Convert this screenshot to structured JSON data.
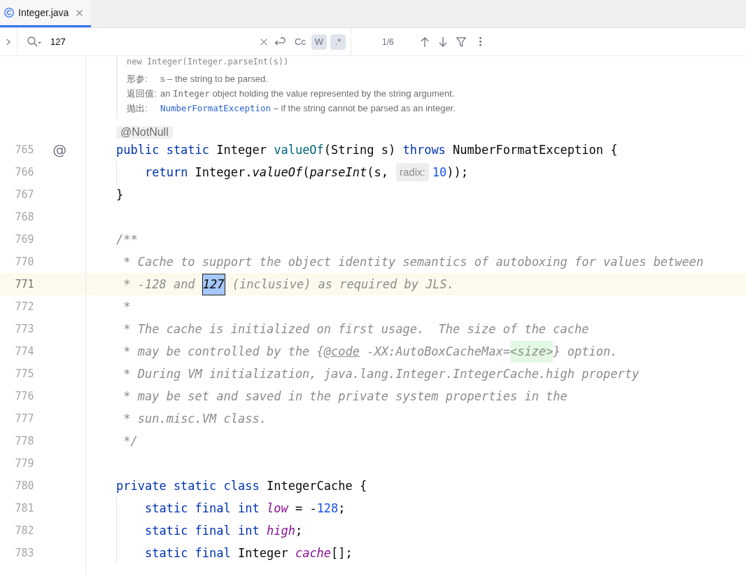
{
  "tabs": [
    {
      "label": "Integer.java",
      "selected": true
    }
  ],
  "search": {
    "value": "127",
    "options": [
      {
        "label": "Cc",
        "selected": false
      },
      {
        "label": "W",
        "selected": true
      },
      {
        "label": ".*",
        "selected": true
      }
    ],
    "match_count": "1/6"
  },
  "editor": {
    "doc": {
      "signature": "new Integer(Integer.parseInt(s))",
      "rows": [
        {
          "label": "形参:",
          "parts": [
            {
              "kind": "text",
              "text": "s – the string to be parsed."
            }
          ]
        },
        {
          "label": "返回值:",
          "parts": [
            {
              "kind": "text",
              "text": "an "
            },
            {
              "kind": "code",
              "text": "Integer"
            },
            {
              "kind": "text",
              "text": " object holding the value represented by the string argument."
            }
          ]
        },
        {
          "label": "抛出:",
          "parts": [
            {
              "kind": "link",
              "text": "NumberFormatException"
            },
            {
              "kind": "text",
              "text": " – if the string cannot be parsed as an integer."
            }
          ]
        }
      ]
    },
    "annotation": "@NotNull",
    "lines": [
      {
        "number": "765",
        "gutter_mark": "@",
        "current": false,
        "tokens": [
          {
            "kind": "keyword",
            "text": "public static"
          },
          {
            "kind": "plain",
            "text": " Integer "
          },
          {
            "kind": "method",
            "text": "valueOf"
          },
          {
            "kind": "plain",
            "text": "(String s) "
          },
          {
            "kind": "keyword",
            "text": "throws"
          },
          {
            "kind": "plain",
            "text": " NumberFormatException {"
          }
        ]
      },
      {
        "number": "766",
        "current": false,
        "tokens": [
          {
            "kind": "keyword",
            "text": "    return"
          },
          {
            "kind": "plain",
            "text": " Integer."
          },
          {
            "kind": "call",
            "text": "valueOf"
          },
          {
            "kind": "plain",
            "text": "("
          },
          {
            "kind": "call",
            "text": "parseInt"
          },
          {
            "kind": "plain",
            "text": "(s,"
          },
          {
            "kind": "hint",
            "text": "radix:"
          },
          {
            "kind": "number",
            "text": "10"
          },
          {
            "kind": "plain",
            "text": "));"
          }
        ]
      },
      {
        "number": "767",
        "current": false,
        "tokens": [
          {
            "kind": "plain",
            "text": "}"
          }
        ]
      },
      {
        "number": "768",
        "current": false
      },
      {
        "number": "769",
        "current": false,
        "tokens": [
          {
            "kind": "comment",
            "text": "/**"
          }
        ]
      },
      {
        "number": "770",
        "current": false,
        "tokens": [
          {
            "kind": "comment",
            "text": " * Cache to support the object identity semantics of autoboxing for values between"
          }
        ]
      },
      {
        "number": "771",
        "current": true,
        "tokens": [
          {
            "kind": "comment",
            "text": " * -128 and "
          },
          {
            "kind": "match",
            "text": "127"
          },
          {
            "kind": "comment",
            "text": " (inclusive) as required by JLS."
          }
        ]
      },
      {
        "number": "772",
        "current": false,
        "tokens": [
          {
            "kind": "comment",
            "text": " *"
          }
        ]
      },
      {
        "number": "773",
        "current": false,
        "tokens": [
          {
            "kind": "comment",
            "text": " * The cache is initialized on first usage.  The size of the cache"
          }
        ]
      },
      {
        "number": "774",
        "current": false,
        "tokens": [
          {
            "kind": "comment",
            "text": " * may be controlled by the {"
          },
          {
            "kind": "doc_tag",
            "text": "@code"
          },
          {
            "kind": "comment",
            "text": " -XX:AutoBoxCacheMax="
          },
          {
            "kind": "markup",
            "text": "<size>"
          },
          {
            "kind": "comment",
            "text": "} option."
          }
        ]
      },
      {
        "number": "775",
        "current": false,
        "tokens": [
          {
            "kind": "comment",
            "text": " * During VM initialization, java.lang.Integer.IntegerCache.high property"
          }
        ]
      },
      {
        "number": "776",
        "current": false,
        "tokens": [
          {
            "kind": "comment",
            "text": " * may be set and saved in the private system properties in the"
          }
        ]
      },
      {
        "number": "777",
        "current": false,
        "tokens": [
          {
            "kind": "comment",
            "text": " * sun.misc.VM class."
          }
        ]
      },
      {
        "number": "778",
        "current": false,
        "tokens": [
          {
            "kind": "comment",
            "text": " */"
          }
        ]
      },
      {
        "number": "779",
        "current": false
      },
      {
        "number": "780",
        "current": false,
        "tokens": [
          {
            "kind": "keyword",
            "text": "private static class"
          },
          {
            "kind": "plain",
            "text": " IntegerCache {"
          }
        ]
      },
      {
        "number": "781",
        "current": false,
        "tokens": [
          {
            "kind": "keyword",
            "text": "    static final int "
          },
          {
            "kind": "field",
            "text": "low"
          },
          {
            "kind": "plain",
            "text": " = -"
          },
          {
            "kind": "number",
            "text": "128"
          },
          {
            "kind": "plain",
            "text": ";"
          }
        ]
      },
      {
        "number": "782",
        "current": false,
        "tokens": [
          {
            "kind": "keyword",
            "text": "    static final int "
          },
          {
            "kind": "field",
            "text": "high"
          },
          {
            "kind": "plain",
            "text": ";"
          }
        ]
      },
      {
        "number": "783",
        "current": false,
        "tokens": [
          {
            "kind": "keyword",
            "text": "    static final"
          },
          {
            "kind": "plain",
            "text": " Integer "
          },
          {
            "kind": "field",
            "text": "cache"
          },
          {
            "kind": "plain",
            "text": "[];"
          }
        ]
      }
    ]
  }
}
